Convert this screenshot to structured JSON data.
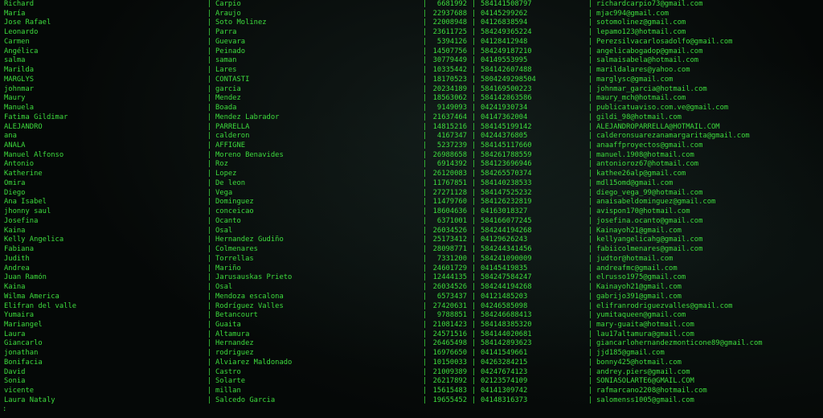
{
  "terminal": {
    "separator": "|",
    "prompt": ":",
    "text_color": "#3ddc3d",
    "background": "#050807",
    "rows": [
      [
        "Richard",
        "Carpio",
        "6681992",
        "584141508797",
        "richardcarpio73@gmail.com"
      ],
      [
        "María",
        "Araujo",
        "22937688",
        "04145299262",
        "mjac994@gmail.com"
      ],
      [
        "Jose Rafael",
        "Soto Molinez",
        "22008948",
        "04126838594",
        "sotomolinez@gmail.com"
      ],
      [
        "Leonardo",
        "Parra",
        "23611725",
        "584249365224",
        "lepamo123@hotmail.com"
      ],
      [
        "Carmen",
        "Guevara",
        "5394126",
        "04128412948",
        "Perezsilvacarlosadolfo@gmail.com"
      ],
      [
        "Angélica",
        "Peinado",
        "14507756",
        "584249187210",
        "angelicabogadop@gmail.com"
      ],
      [
        "salma",
        "saman",
        "30779449",
        "04149553995",
        "salmaisabela@hotmail.com"
      ],
      [
        "Marilda",
        "Lares",
        "10335442",
        "584142607488",
        "marildalares@yahoo.com"
      ],
      [
        "MARGLYS",
        "CONTASTI",
        "18170523",
        "5804249298504",
        "marglysc@gmail.com"
      ],
      [
        "johnmar",
        "garcia",
        "20234189",
        "584169500223",
        "johnmar_garcia@hotmail.com"
      ],
      [
        "Maury",
        "Mendez",
        "18563062",
        "584142863586",
        "maury_mch@hotmail.com"
      ],
      [
        "Manuela",
        "Boada",
        "9149093",
        "04241930734",
        "publicatuaviso.com.ve@gmail.com"
      ],
      [
        "Fatima Gildimar",
        "Mendez Labrador",
        "21637464",
        "04147362004",
        "gildi_98@hotmail.com"
      ],
      [
        "ALEJANDRO",
        "PARRELLA",
        "14815216",
        "584145199142",
        "ALEJANDROPARRELLA@HOTMAIL.COM"
      ],
      [
        "ana",
        "calderon",
        "4167347",
        "04244376805",
        "calderonsuarezanamargarita@gmail.com"
      ],
      [
        "ANALA",
        "AFFIGNE",
        "5237239",
        "584145117660",
        "anaaffproyectos@gmail.com"
      ],
      [
        "Manuel Alfonso",
        "Moreno Benavides",
        "26988658",
        "584261788559",
        "manuel.1908@hotmail.com"
      ],
      [
        "Antonio",
        "Roz",
        "6914392",
        "584123696946",
        "antonioroz67@hotmail.com"
      ],
      [
        "Katherine",
        "Lopez",
        "26120083",
        "584265570374",
        "kathee26alp@gmail.com"
      ],
      [
        "Omira",
        "De leon",
        "11767851",
        "584140238533",
        "mdl15omd@gmail.com"
      ],
      [
        "Diego",
        "Vega",
        "27271128",
        "584147525232",
        "diego_vega_99@hotmail.com"
      ],
      [
        "Ana Isabel",
        "Dominguez",
        "11479760",
        "584126232819",
        "anaisabeldominguez@gmail.com"
      ],
      [
        "jhonny saul",
        "conceicao",
        "18604636",
        "04163018327",
        "avispon170@hotmail.com"
      ],
      [
        "Josefina",
        "Ocanto",
        "6371001",
        "584166077245",
        "josefina.ocanto@gmail.com"
      ],
      [
        "Kaina",
        "Osal",
        "26034526",
        "584244194268",
        "Kainayoh21@gmail.com"
      ],
      [
        "Kelly Angelica",
        "Hernandez Gudiño",
        "25173412",
        "04129626243",
        "kellyangelicahg@gmail.com"
      ],
      [
        "Fabiana",
        "Colmenares",
        "28098771",
        "584244341456",
        "fabiicolmenares@gmail.com"
      ],
      [
        "Judith",
        "Torrellas",
        "7331200",
        "584241090009",
        "judtor@hotmail.com"
      ],
      [
        "Andrea",
        "Mariño",
        "24601729",
        "04145419835",
        "andreafmc@gmail.com"
      ],
      [
        "Juan Ramón",
        "Jarusauskas Prieto",
        "12444135",
        "584247584247",
        "elrusso1975@gmail.com"
      ],
      [
        "Kaina",
        "Osal",
        "26034526",
        "584244194268",
        "Kainayoh21@gmail.com"
      ],
      [
        "Wilma America",
        "Mendoza escalona",
        "6573437",
        "04121485203",
        "gabrijo391@gmail.com"
      ],
      [
        "Elifran del valle",
        "Rodríguez Valles",
        "27420631",
        "04246585098",
        "elifranrodriguezvalles@gmail.com"
      ],
      [
        "Yumaira",
        "Betancourt",
        "9788851",
        "584246688413",
        "yumitaqueen@gmail.com"
      ],
      [
        "Mariangel",
        "Guaita",
        "21081423",
        "584148385320",
        "mary-guaita@hotmail.com"
      ],
      [
        "Laura",
        "Altamura",
        "24571516",
        "584144020681",
        "lau17altamura@gmail.com"
      ],
      [
        "Giancarlo",
        "Hernandez",
        "26465498",
        "584142893623",
        "giancarlohernandezmonticone89@gmail.com"
      ],
      [
        "jonathan",
        "rodriguez",
        "16976650",
        "04141549661",
        "jjd185@gmail.com"
      ],
      [
        "Bonifacia",
        "Alviarez Maldonado",
        "10150033",
        "04263284215",
        "bonny425@hotmail.com"
      ],
      [
        "David",
        "Castro",
        "21009389",
        "04247674123",
        "andrey.piers@gmail.com"
      ],
      [
        "Sonia",
        "Solarte",
        "26217892",
        "02123574109",
        "SONIASOLARTE6@GMAIL.COM"
      ],
      [
        "vicente",
        "millan",
        "15615483",
        "04141309742",
        "rafmarcano2208@hotmail.com"
      ],
      [
        "Laura Nataly",
        "Salcedo Garcia",
        "19655452",
        "04148316373",
        "salomenss1005@gmail.com"
      ]
    ]
  }
}
